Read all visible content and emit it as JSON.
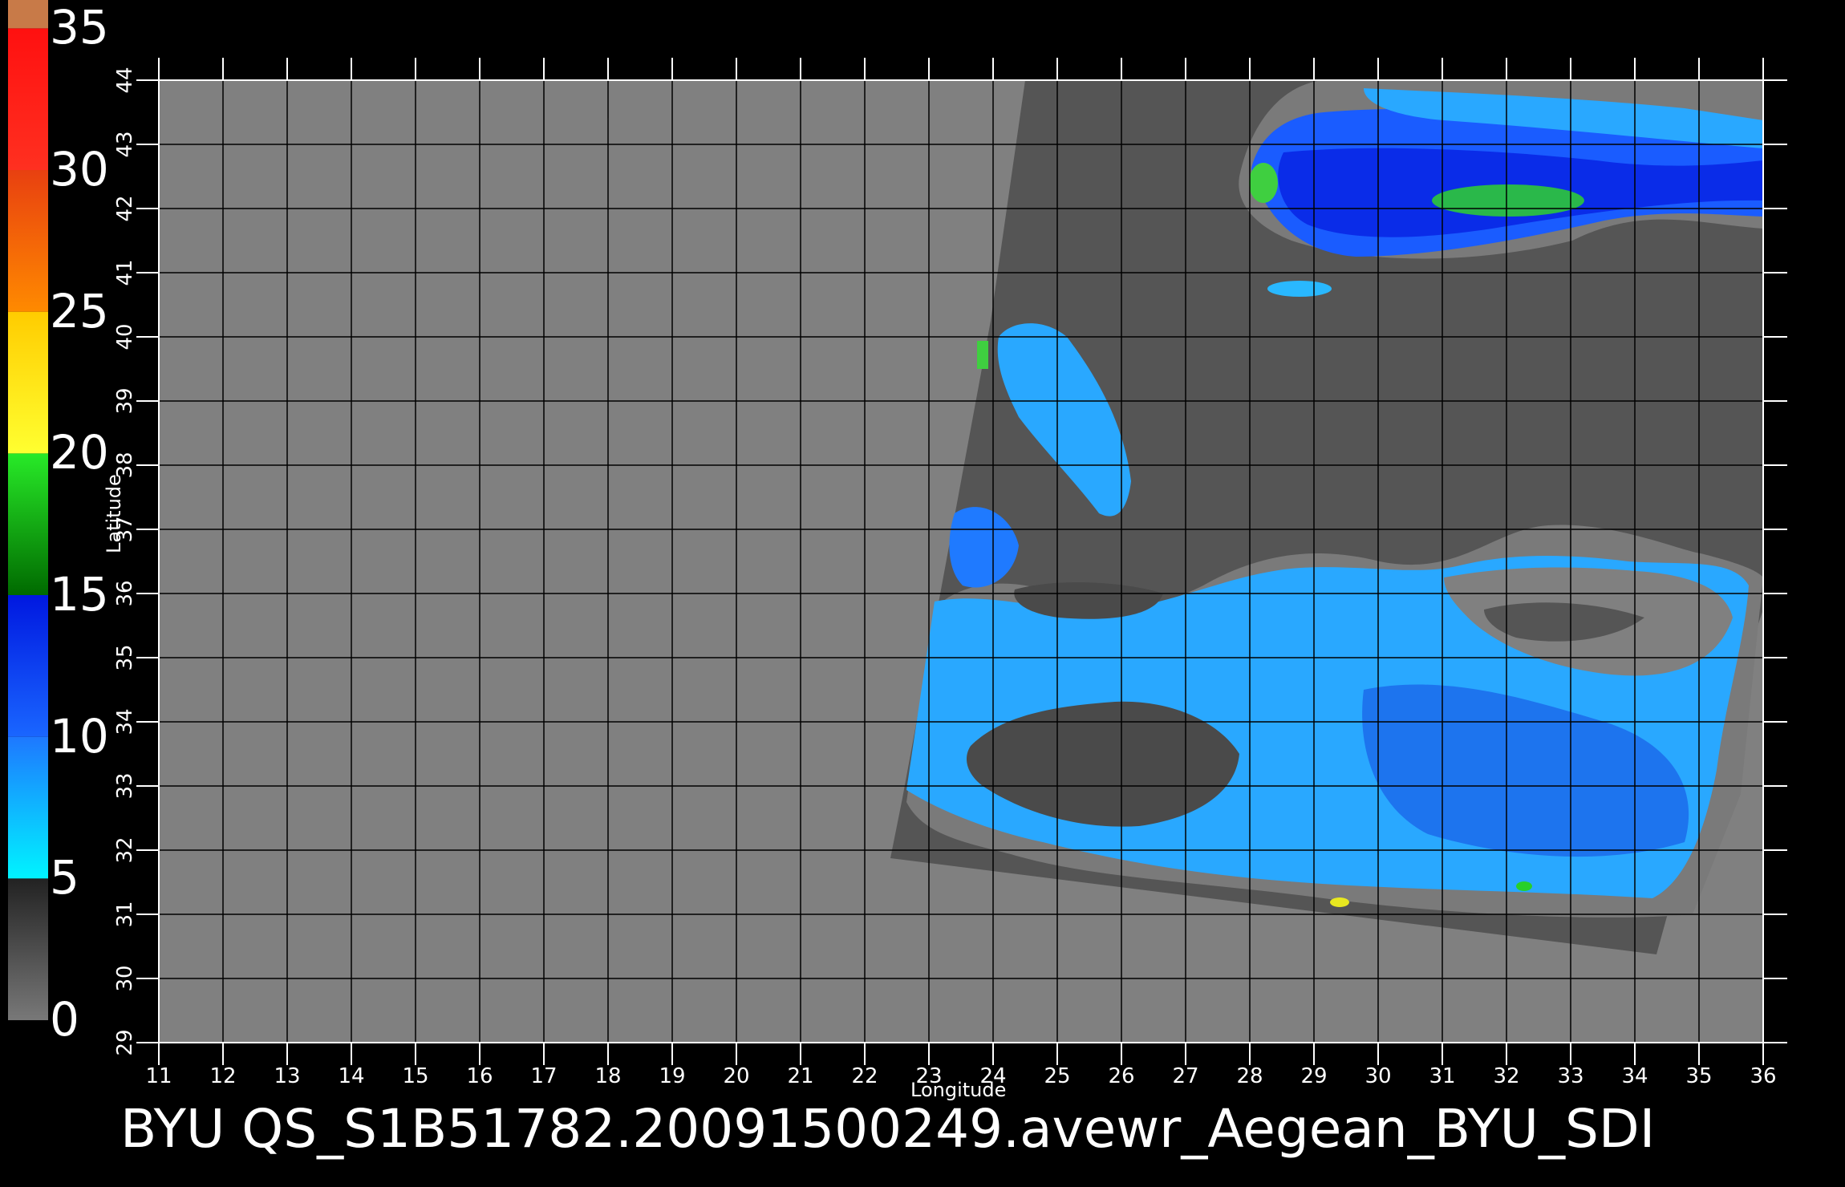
{
  "colorbar": {
    "stops": [
      {
        "from": 0,
        "to": 5,
        "colors": [
          "#787878",
          "#222222"
        ]
      },
      {
        "from": 5,
        "to": 10,
        "colors": [
          "#00f4ff",
          "#1e78ff"
        ]
      },
      {
        "from": 10,
        "to": 15,
        "colors": [
          "#1a66ff",
          "#0018e0"
        ]
      },
      {
        "from": 15,
        "to": 20,
        "colors": [
          "#006a00",
          "#28ea28"
        ]
      },
      {
        "from": 20,
        "to": 25,
        "colors": [
          "#ffff30",
          "#ffcc00"
        ]
      },
      {
        "from": 25,
        "to": 30,
        "colors": [
          "#ff8a00",
          "#e84010"
        ]
      },
      {
        "from": 30,
        "to": 35,
        "colors": [
          "#ff3020",
          "#ff1010"
        ]
      },
      {
        "from": 35,
        "to": 36,
        "colors": [
          "#c87a48",
          "#c87a48"
        ]
      }
    ],
    "labels": [
      "0",
      "5",
      "10",
      "15",
      "20",
      "25",
      "30",
      "35"
    ]
  },
  "chart_data": {
    "type": "heatmap",
    "xlabel": "Longitude",
    "ylabel": "Latitude",
    "xlim": [
      11,
      36
    ],
    "ylim": [
      29,
      44
    ],
    "x_ticks": [
      "11",
      "12",
      "13",
      "14",
      "15",
      "16",
      "17",
      "18",
      "19",
      "20",
      "21",
      "22",
      "23",
      "24",
      "25",
      "26",
      "27",
      "28",
      "29",
      "30",
      "31",
      "32",
      "33",
      "34",
      "35",
      "36"
    ],
    "y_ticks": [
      "29",
      "30",
      "31",
      "32",
      "33",
      "34",
      "35",
      "36",
      "37",
      "38",
      "39",
      "40",
      "41",
      "42",
      "43",
      "44"
    ],
    "background_color": "#808080",
    "land_color": "#505050",
    "grid": true
  },
  "footer": {
    "text": "BYU  QS_S1B51782.20091500249.avewr_Aegean_BYU_SDI"
  }
}
